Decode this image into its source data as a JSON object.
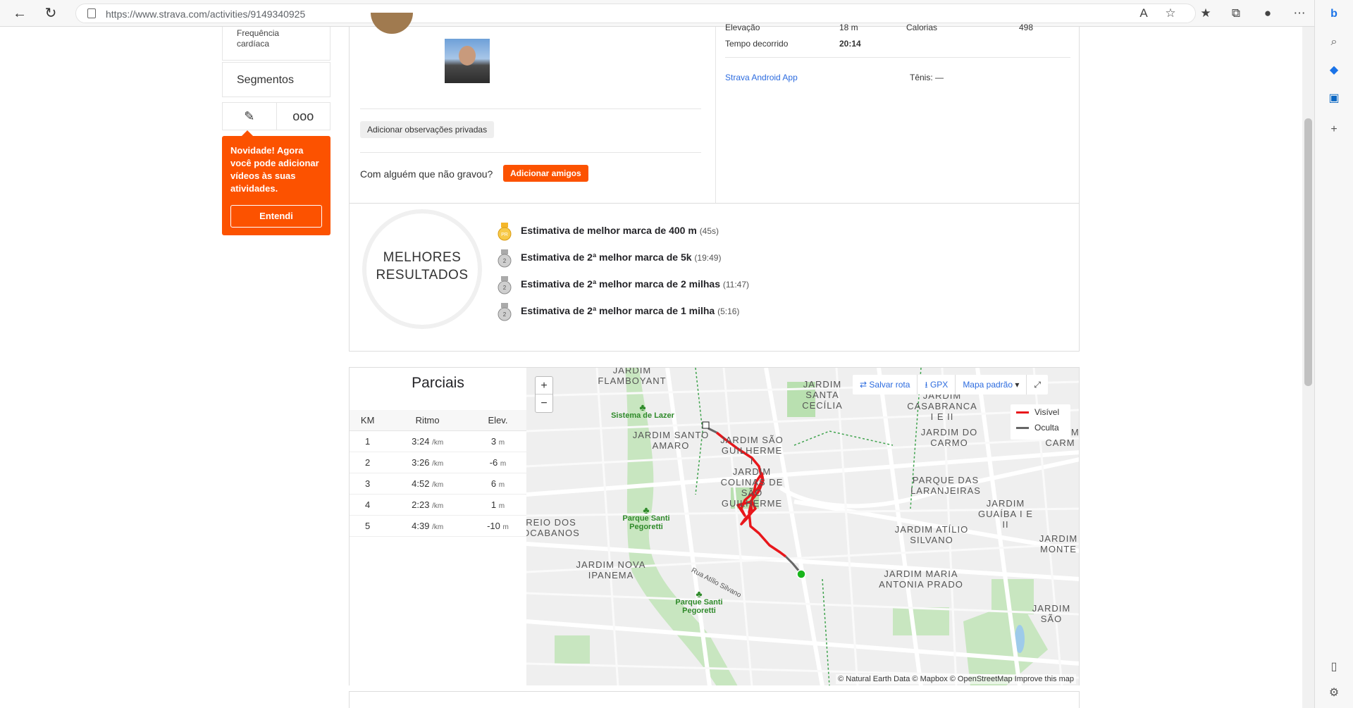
{
  "browser": {
    "url": "https://www.strava.com/activities/9149340925"
  },
  "left_nav": {
    "heart_rate_label": "Frequência cardíaca",
    "segments_label": "Segmentos"
  },
  "popup": {
    "message": "Novidade! Agora você pode adicionar vídeos às suas atividades.",
    "button": "Entendi"
  },
  "activity": {
    "private_notes_button": "Adicionar observações privadas",
    "with_someone_text": "Com alguém que não gravou?",
    "add_friends_button": "Adicionar amigos",
    "stats": {
      "elevation_label": "Elevação",
      "elevation_value": "18 m",
      "calories_label": "Calorias",
      "calories_value": "498",
      "elapsed_label": "Tempo decorrido",
      "elapsed_value": "20:14"
    },
    "device": "Strava Android App",
    "shoes": "Tênis: —"
  },
  "best_efforts": {
    "title_line1": "MELHORES",
    "title_line2": "RESULTADOS",
    "items": [
      {
        "text": "Estimativa de melhor marca de 400 m",
        "time": "(45s)",
        "medal": "gold"
      },
      {
        "text": "Estimativa de 2ª melhor marca de 5k",
        "time": "(19:49)",
        "medal": "silver"
      },
      {
        "text": "Estimativa de 2ª melhor marca de 2 milhas",
        "time": "(11:47)",
        "medal": "silver"
      },
      {
        "text": "Estimativa de 2ª melhor marca de 1 milha",
        "time": "(5:16)",
        "medal": "silver"
      }
    ]
  },
  "splits": {
    "title": "Parciais",
    "headers": [
      "KM",
      "Ritmo",
      "Elev."
    ],
    "pace_unit": "/km",
    "elev_unit": "m",
    "rows": [
      {
        "km": "1",
        "pace": "3:24",
        "elev": "3"
      },
      {
        "km": "2",
        "pace": "3:26",
        "elev": "-6"
      },
      {
        "km": "3",
        "pace": "4:52",
        "elev": "6"
      },
      {
        "km": "4",
        "pace": "2:23",
        "elev": "1"
      },
      {
        "km": "5",
        "pace": "4:39",
        "elev": "-10"
      }
    ]
  },
  "map": {
    "zoom_in": "+",
    "zoom_out": "−",
    "save_route": "Salvar rota",
    "gpx": "GPX",
    "map_style": "Mapa padrão",
    "legend_visible": "Visível",
    "legend_hidden": "Oculta",
    "attribution": "© Natural Earth Data © Mapbox © OpenStreetMap Improve this map",
    "route_color": "#e8161b",
    "hidden_color": "#666666",
    "labels": [
      "JARDIM FLAMBOYANT",
      "JARDIM SANTO AMARO",
      "JARDIM SÃO GUILHERME I",
      "JARDIM COLINAS DE SÃO GUILHERME",
      "JARDIM SANTA CECÍLIA",
      "JARDIM CASABRANCA I E II",
      "JARDIM DO CARMO",
      "PARQUE DAS LARANJEIRAS",
      "JARDIM GUAÍBA I E II",
      "JARDIM ATÍLIO SILVANO",
      "JARDIM MARIA ANTONIA PRADO",
      "JARDIM NOVA IPANEMA",
      "REIO DOS OCABANOS",
      "JARDIM MONTE",
      "JARDIM CARM",
      "JARDIM SÃO"
    ],
    "parks": [
      "Sistema de Lazer",
      "Parque Santi Pegoretti",
      "Parque Santi Pegoretti"
    ],
    "street": "Rua Atílio Silvano"
  }
}
